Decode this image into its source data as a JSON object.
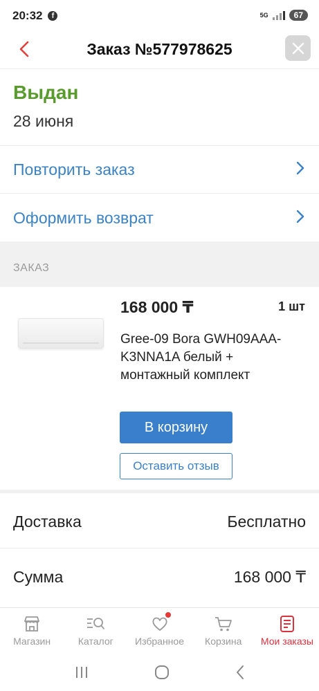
{
  "status_bar": {
    "time": "20:32",
    "network": "5G",
    "battery": "67"
  },
  "header": {
    "title": "Заказ №577978625"
  },
  "order": {
    "status": "Выдан",
    "date": "28 июня"
  },
  "actions": {
    "repeat_label": "Повторить заказ",
    "return_label": "Оформить возврат"
  },
  "section": {
    "title": "ЗАКАЗ"
  },
  "product": {
    "price": "168 000 ₸",
    "quantity": "1 шт",
    "name": "Gree-09 Bora GWH09AAA-K3NNA1A белый + монтажный комплект",
    "cart_button": "В корзину",
    "review_button": "Оставить отзыв"
  },
  "summary": {
    "delivery_label": "Доставка",
    "delivery_value": "Бесплатно",
    "total_label": "Сумма",
    "total_value": "168 000 ₸"
  },
  "bottom_nav": {
    "items": [
      {
        "label": "Магазин",
        "icon": "store-icon"
      },
      {
        "label": "Каталог",
        "icon": "catalog-search-icon"
      },
      {
        "label": "Избранное",
        "icon": "heart-icon"
      },
      {
        "label": "Корзина",
        "icon": "cart-icon"
      },
      {
        "label": "Мои заказы",
        "icon": "orders-icon"
      }
    ],
    "active_index": 4
  },
  "colors": {
    "accent_blue": "#3a7fcc",
    "status_green": "#5a9b2e",
    "active_red": "#d9323f",
    "back_red": "#e0403a"
  }
}
